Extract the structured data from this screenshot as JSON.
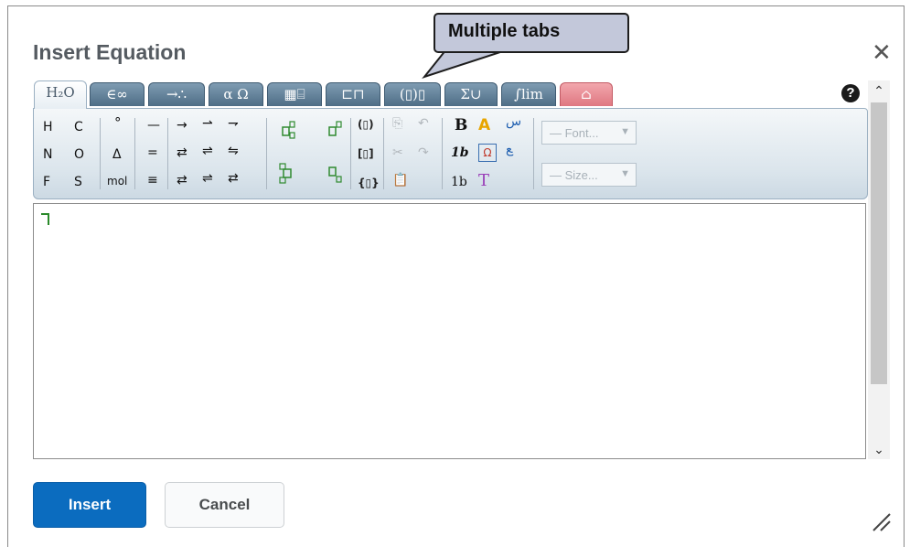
{
  "dialog": {
    "title": "Insert Equation",
    "close_icon": "close-icon"
  },
  "callout": {
    "text": "Multiple tabs"
  },
  "tabs": [
    {
      "label": "H₂O",
      "active": true
    },
    {
      "label": "∈∞"
    },
    {
      "label": "→∴"
    },
    {
      "label": "α Ω"
    },
    {
      "label": "▦⌸"
    },
    {
      "label": "⊏⊓"
    },
    {
      "label": "(▯)▯"
    },
    {
      "label": "Σ∪"
    },
    {
      "label": "∫lim"
    },
    {
      "label": "⌂",
      "style": "pink"
    }
  ],
  "help": {
    "text": "?"
  },
  "toolbar": {
    "elements": [
      "H",
      "C",
      "N",
      "O",
      "F",
      "S"
    ],
    "misc": [
      "°",
      "Δ",
      "mol"
    ],
    "bonds": [
      "—",
      "=",
      "≡"
    ],
    "arrows": [
      "→",
      "⇀",
      "⇁",
      "⇄",
      "⇌",
      "⇋",
      "⇄",
      "⇌",
      "⇄"
    ],
    "brackets": [
      "(▯)",
      "[▯]",
      "{▯}"
    ],
    "bold_label": "B",
    "italic_label": "1b",
    "normal_label": "1b",
    "text_label": "T",
    "font_select": "— Font...",
    "size_select": "— Size..."
  },
  "buttons": {
    "insert": "Insert",
    "cancel": "Cancel"
  },
  "colors": {
    "primary": "#0b6cbf",
    "tab": "#5b7a92",
    "tab_pink": "#e2848d"
  }
}
